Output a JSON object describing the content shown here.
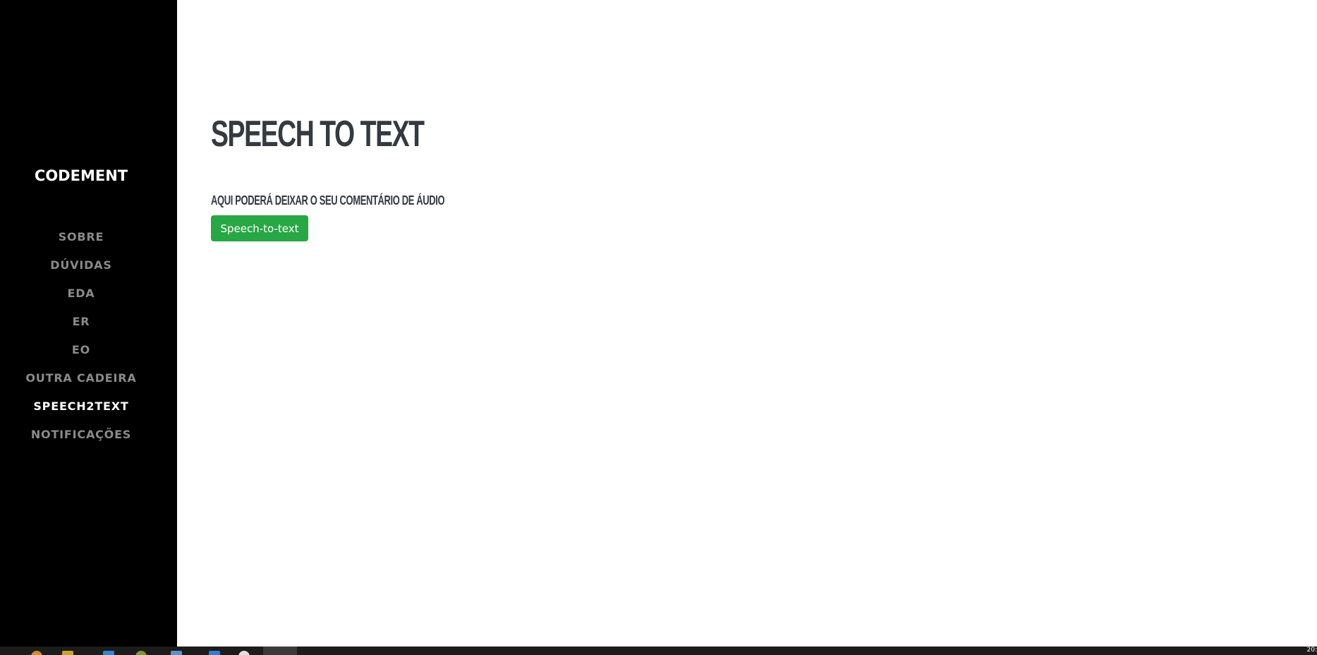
{
  "sidebar": {
    "brand": "CODEMENT",
    "items": [
      {
        "label": "SOBRE",
        "active": false
      },
      {
        "label": "DÚVIDAS",
        "active": false
      },
      {
        "label": "EDA",
        "active": false
      },
      {
        "label": "ER",
        "active": false
      },
      {
        "label": "EO",
        "active": false
      },
      {
        "label": "OUTRA CADEIRA",
        "active": false
      },
      {
        "label": "SPEECH2TEXT",
        "active": true
      },
      {
        "label": "NOTIFICAÇÕES",
        "active": false
      }
    ]
  },
  "main": {
    "title": "SPEECH TO TEXT",
    "subtitle": "AQUI PODERÁ DEIXAR O SEU COMENTÁRIO DE ÁUDIO",
    "button_label": "Speech-to-text"
  },
  "taskbar": {
    "clock": "20:"
  },
  "colors": {
    "sidebar_bg": "#000000",
    "nav_inactive": "#8a8a8a",
    "nav_active": "#ffffff",
    "heading": "#343a40",
    "button_bg": "#28a745"
  }
}
